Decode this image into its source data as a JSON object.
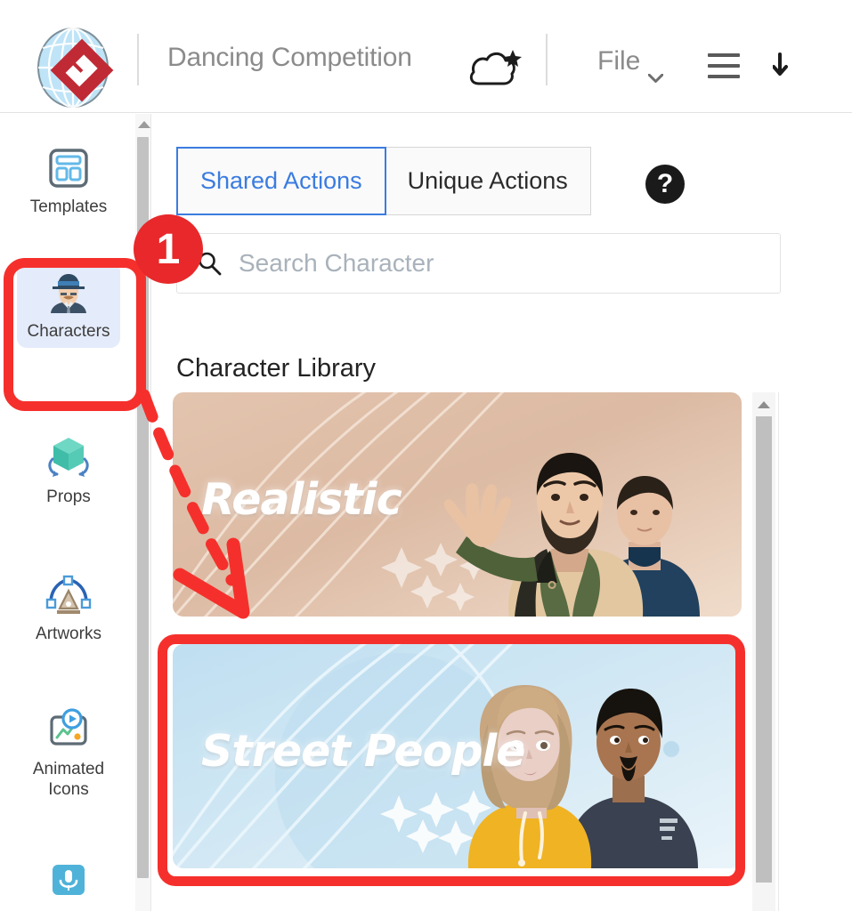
{
  "app": {
    "logo_icon": "reallusion-globe-logo",
    "document_title": "Dancing Competition",
    "cloud_icon": "cloud-star-icon",
    "file_menu_label": "File",
    "chevron_icon": "chevron-down-icon",
    "hamburger_icon": "hamburger-menu-icon",
    "download_icon": "download-icon"
  },
  "sidebar": {
    "items": [
      {
        "label": "Templates",
        "icon": "templates-layout-icon",
        "selected": false
      },
      {
        "label": "Characters",
        "icon": "character-avatar-icon",
        "selected": true
      },
      {
        "label": "Props",
        "icon": "rotating-cube-icon",
        "selected": false
      },
      {
        "label": "Artworks",
        "icon": "pen-nib-curve-icon",
        "selected": false
      },
      {
        "label": "Animated\nIcons",
        "label_line1": "Animated",
        "label_line2": "Icons",
        "icon": "animated-icons-icon",
        "selected": false
      },
      {
        "label": "",
        "icon": "microphone-icon",
        "selected": false
      }
    ],
    "scrollbar": {
      "up_arrow_icon": "scroll-up-arrow-icon"
    }
  },
  "main": {
    "tabs": [
      {
        "label": "Shared Actions",
        "active": true
      },
      {
        "label": "Unique Actions",
        "active": false
      }
    ],
    "help_icon_label": "?",
    "search": {
      "icon": "search-icon",
      "value": "",
      "placeholder": "Search Character"
    },
    "library_heading": "Character Library",
    "cards": [
      {
        "title": "Realistic",
        "theme_color": "#d9b49d",
        "highlighted": false
      },
      {
        "title": "Street People",
        "theme_color": "#b7d9ec",
        "highlighted": true
      }
    ],
    "scrollbar": {
      "up_arrow_icon": "scroll-up-arrow-icon"
    }
  },
  "annotations": {
    "step_badge": "1",
    "badge_color": "#e8282a",
    "highlight_color": "#f5302c",
    "highlight_targets": [
      "sidebar-item-characters",
      "card-street-people"
    ],
    "arrow": {
      "style": "dashed",
      "color": "#f5302c",
      "from": "sidebar-item-characters",
      "to": "card-street-people"
    }
  }
}
